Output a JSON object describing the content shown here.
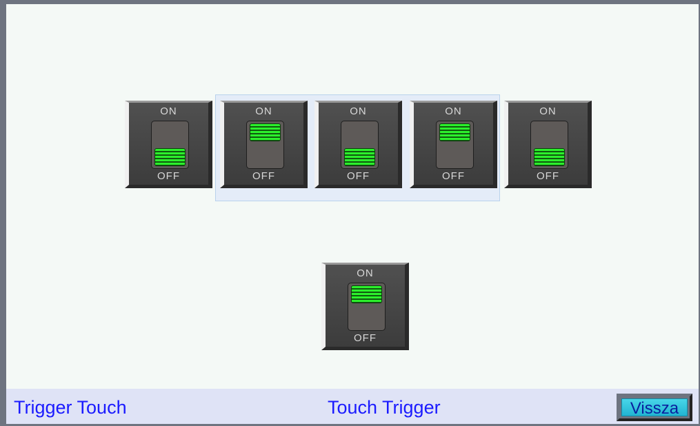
{
  "switches": [
    {
      "on_label": "ON",
      "off_label": "OFF",
      "state": "off"
    },
    {
      "on_label": "ON",
      "off_label": "OFF",
      "state": "on"
    },
    {
      "on_label": "ON",
      "off_label": "OFF",
      "state": "off"
    },
    {
      "on_label": "ON",
      "off_label": "OFF",
      "state": "on"
    },
    {
      "on_label": "ON",
      "off_label": "OFF",
      "state": "off"
    }
  ],
  "bottom_switch": {
    "on_label": "ON",
    "off_label": "OFF",
    "state": "on"
  },
  "footer": {
    "left_text": "Trigger Touch",
    "center_text": "Touch Trigger",
    "back_label": "Vissza"
  },
  "colors": {
    "indicator_green": "#2cf02c",
    "footer_text": "#1b1bff",
    "back_button": "#22b4d2"
  }
}
